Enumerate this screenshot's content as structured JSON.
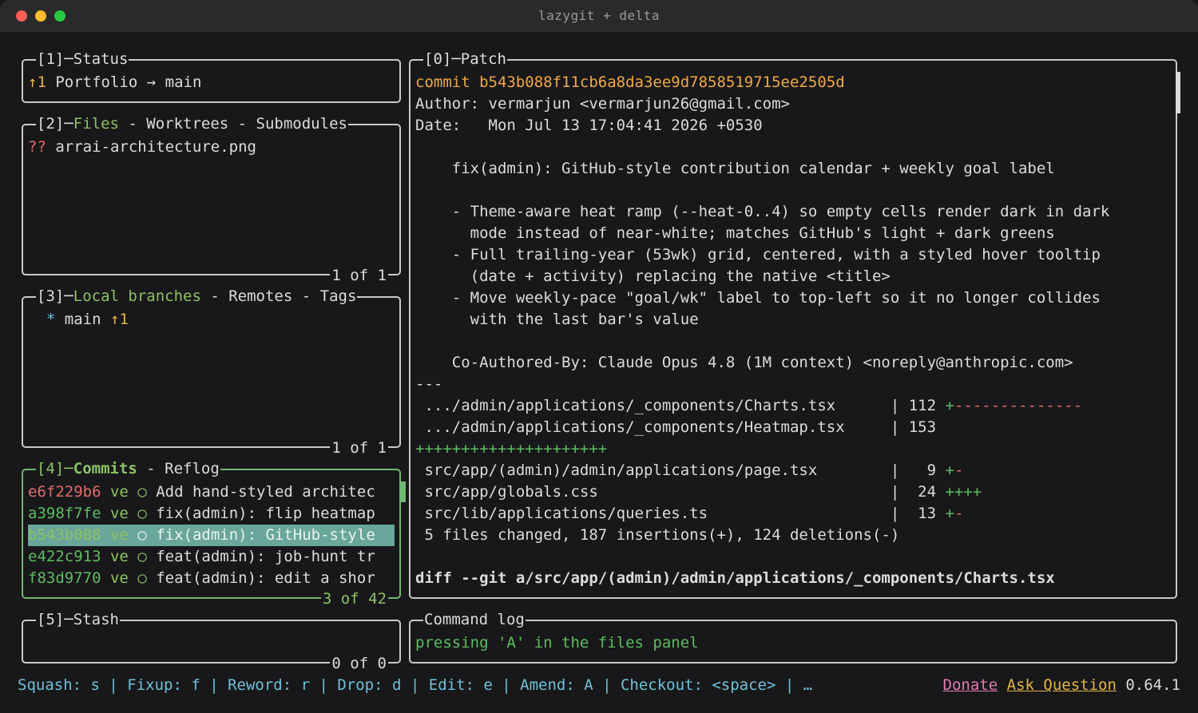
{
  "window": {
    "title": "lazygit + delta"
  },
  "status": {
    "title": "[1]─Status",
    "ahead": "↑1",
    "repo": "Portfolio",
    "arrow": "→",
    "branch": "main"
  },
  "files": {
    "title_prefix": "[2]─",
    "tab_active": "Files",
    "tab_rest": " - Worktrees - Submodules",
    "items": [
      {
        "status": "??",
        "name": "arrai-architecture.png"
      }
    ],
    "footer": "1 of 1"
  },
  "branches": {
    "title_prefix": "[3]─",
    "tab_active": "Local branches",
    "tab_rest": " - Remotes - Tags",
    "items": [
      {
        "marker": "*",
        "name": "main",
        "ahead": "↑1"
      }
    ],
    "footer": "1 of 1"
  },
  "commits": {
    "title_prefix": "[4]─",
    "tab_active": "Commits",
    "tab_rest": " - Reflog",
    "items": [
      {
        "hash": "e6f229b6",
        "author": "ve",
        "marker": "○",
        "msg": "Add hand-styled architec"
      },
      {
        "hash": "a398f7fe",
        "author": "ve",
        "marker": "○",
        "msg": "fix(admin): flip heatmap"
      },
      {
        "hash": "b543b088",
        "author": "ve",
        "marker": "○",
        "msg": "fix(admin): GitHub-style"
      },
      {
        "hash": "e422c913",
        "author": "ve",
        "marker": "○",
        "msg": "feat(admin): job-hunt tr"
      },
      {
        "hash": "f83d9770",
        "author": "ve",
        "marker": "○",
        "msg": "feat(admin): edit a shor"
      }
    ],
    "footer": "3 of 42"
  },
  "stash": {
    "title": "[5]─Stash",
    "footer": "0 of 0"
  },
  "patch": {
    "title": "[0]─Patch",
    "commit_line": "commit b543b088f11cb6a8da3ee9d7858519715ee2505d",
    "author_line": "Author: vermarjun <vermarjun26@gmail.com>",
    "date_line": "Date:   Mon Jul 13 17:04:41 2026 +0530",
    "subject": "    fix(admin): GitHub-style contribution calendar + weekly goal label",
    "body": [
      "    - Theme-aware heat ramp (--heat-0..4) so empty cells render dark in dark",
      "      mode instead of near-white; matches GitHub's light + dark greens",
      "    - Full trailing-year (53wk) grid, centered, with a styled hover tooltip",
      "      (date + activity) replacing the native <title>",
      "    - Move weekly-pace \"goal/wk\" label to top-left so it no longer collides",
      "      with the last bar's value"
    ],
    "coauthor": "    Co-Authored-By: Claude Opus 4.8 (1M context) <noreply@anthropic.com>",
    "separator": "---",
    "stats": [
      {
        "path": " .../admin/applications/_components/Charts.tsx      ",
        "sep": "|",
        "count": " 112 ",
        "plus": "+",
        "minus": "--------------",
        "wrap": ""
      },
      {
        "path": " .../admin/applications/_components/Heatmap.tsx     ",
        "sep": "|",
        "count": " 153",
        "plus": "",
        "minus": "",
        "wrap": "+++++++++++++++++++++"
      },
      {
        "path": " src/app/(admin)/admin/applications/page.tsx        ",
        "sep": "|",
        "count": "   9 ",
        "plus": "+",
        "minus": "-",
        "wrap": ""
      },
      {
        "path": " src/app/globals.css                                ",
        "sep": "|",
        "count": "  24 ",
        "plus": "++++",
        "minus": "",
        "wrap": ""
      },
      {
        "path": " src/lib/applications/queries.ts                    ",
        "sep": "|",
        "count": "  13 ",
        "plus": "+",
        "minus": "-",
        "wrap": ""
      }
    ],
    "summary": " 5 files changed, 187 insertions(+), 124 deletions(-)",
    "diff_line": "diff --git a/src/app/(admin)/admin/applications/_components/Charts.tsx"
  },
  "command_log": {
    "title": "Command log",
    "message": "pressing 'A' in the files panel"
  },
  "keybindings": "Squash: s | Fixup: f | Reword: r | Drop: d | Edit: e | Amend: A | Checkout: <space> | …",
  "links": {
    "donate": "Donate",
    "ask": "Ask Question",
    "version": "0.64.1"
  }
}
